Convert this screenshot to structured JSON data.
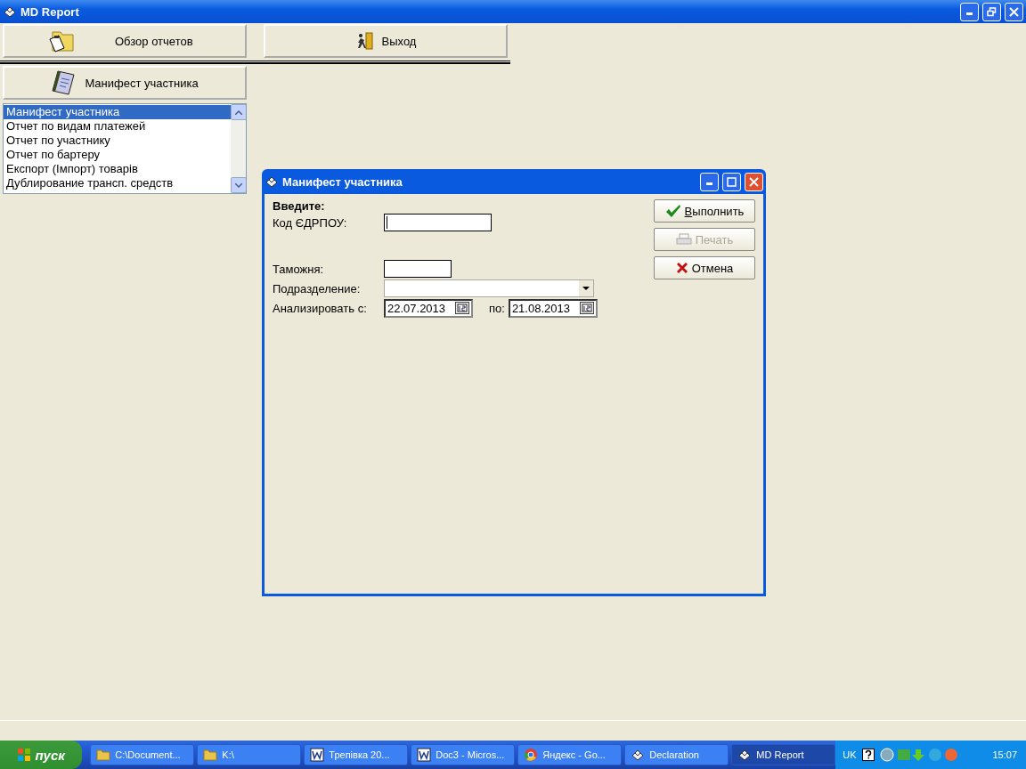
{
  "window": {
    "title": "MD Report"
  },
  "toolbar": [
    {
      "label": "Обзор отчетов",
      "kind": "overview"
    },
    {
      "label": "Выход",
      "kind": "exit"
    }
  ],
  "report_button": {
    "label": "Манифест участника"
  },
  "report_list": [
    {
      "label": "Манифест участника",
      "selected": true
    },
    {
      "label": "Отчет по видам платежей",
      "selected": false
    },
    {
      "label": "Отчет по участнику",
      "selected": false
    },
    {
      "label": "Отчет по бартеру",
      "selected": false
    },
    {
      "label": "Експорт (Імпорт) товарів",
      "selected": false
    },
    {
      "label": "Дублирование трансп. средств",
      "selected": false
    }
  ],
  "dialog": {
    "title": "Манифест участника",
    "heading": "Введите:",
    "fields": [
      {
        "kind": "text",
        "label": "Код ЄДРПОУ:",
        "focused": true
      },
      {
        "kind": "short_text",
        "label": "Таможня:"
      },
      {
        "kind": "combo",
        "label": "Подразделение:"
      },
      {
        "kind": "date_range",
        "label": "Анализировать с:",
        "from": "22.07.2013",
        "to_label": "по:",
        "to": "21.08.2013"
      }
    ],
    "buttons": [
      {
        "label": "Выполнить",
        "kind": "run",
        "disabled": false,
        "underline_first": true
      },
      {
        "label": "Печать",
        "kind": "print",
        "disabled": true,
        "underline_first": false
      },
      {
        "label": "Отмена",
        "kind": "cancel",
        "disabled": false,
        "underline_first": false
      }
    ]
  },
  "taskbar": {
    "start": "пуск",
    "tasks": [
      {
        "label": "C:\\Document...",
        "kind": "folder",
        "selected": false
      },
      {
        "label": "K:\\",
        "kind": "folder",
        "selected": false
      },
      {
        "label": "Трепівка 20...",
        "kind": "word",
        "selected": false
      },
      {
        "label": "Doc3 - Micros...",
        "kind": "word",
        "selected": false
      },
      {
        "label": "Яндекс - Go...",
        "kind": "browser",
        "selected": false
      },
      {
        "label": "Declaration",
        "kind": "app",
        "selected": false
      },
      {
        "label": "MD Report",
        "kind": "app",
        "selected": true
      }
    ],
    "language": "UK",
    "clock": "15:07"
  }
}
